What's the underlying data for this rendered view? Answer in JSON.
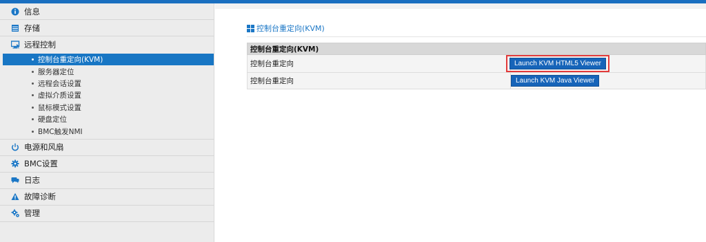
{
  "sidebar": {
    "items": [
      {
        "label": "信息",
        "icon": "info-icon"
      },
      {
        "label": "存储",
        "icon": "storage-icon"
      },
      {
        "label": "远程控制",
        "icon": "monitor-icon"
      },
      {
        "label": "电源和风扇",
        "icon": "power-icon"
      },
      {
        "label": "BMC设置",
        "icon": "gear-icon"
      },
      {
        "label": "日志",
        "icon": "log-icon"
      },
      {
        "label": "故障诊断",
        "icon": "warning-icon"
      },
      {
        "label": "管理",
        "icon": "manage-gear-icon"
      }
    ],
    "remote_subitems": [
      {
        "label": "控制台重定向(KVM)",
        "active": true
      },
      {
        "label": "服务器定位",
        "active": false
      },
      {
        "label": "远程会话设置",
        "active": false
      },
      {
        "label": "虚拟介质设置",
        "active": false
      },
      {
        "label": "鼠标模式设置",
        "active": false
      },
      {
        "label": "硬盘定位",
        "active": false
      },
      {
        "label": "BMC触发NMI",
        "active": false
      }
    ]
  },
  "main": {
    "title": "控制台重定向(KVM)",
    "table": {
      "header": "控制台重定向(KVM)",
      "rows": [
        {
          "label": "控制台重定向",
          "button": "Launch KVM HTML5 Viewer"
        },
        {
          "label": "控制台重定向",
          "button": "Launch KVM Java Viewer"
        }
      ]
    }
  },
  "colors": {
    "accent": "#1876c4",
    "button": "#1664b9",
    "highlight": "#e23a3a",
    "sidebar_bg": "#ececec"
  }
}
